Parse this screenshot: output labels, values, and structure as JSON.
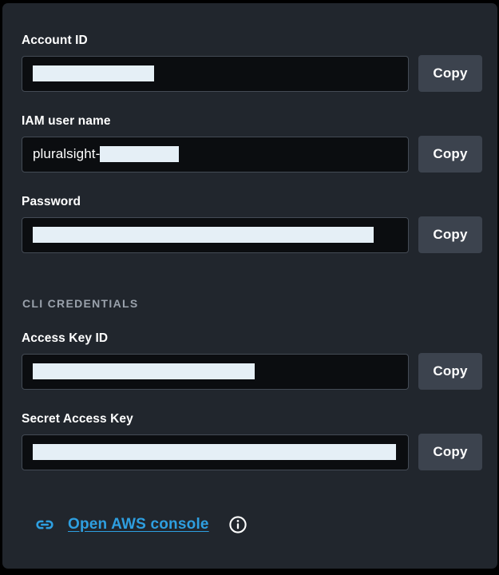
{
  "panel": {
    "background_color": "#21262d"
  },
  "fields": [
    {
      "label": "Account ID",
      "value_prefix": "",
      "redacted": true,
      "redaction_width": 152,
      "copy_label": "Copy"
    },
    {
      "label": "IAM user name",
      "value_prefix": "pluralsight-",
      "redacted": true,
      "redaction_width": 99,
      "copy_label": "Copy"
    },
    {
      "label": "Password",
      "value_prefix": "",
      "redacted": true,
      "redaction_width": 427,
      "copy_label": "Copy"
    }
  ],
  "cli_section": {
    "header": "CLI CREDENTIALS",
    "header_color": "#9aa2ac",
    "fields": [
      {
        "label": "Access Key ID",
        "value_prefix": "",
        "redacted": true,
        "redaction_width": 278,
        "copy_label": "Copy"
      },
      {
        "label": "Secret Access Key",
        "value_prefix": "",
        "redacted": true,
        "redaction_width": 455,
        "copy_label": "Copy"
      }
    ]
  },
  "footer": {
    "link_icon_name": "link-icon",
    "link_label": "Open AWS console",
    "link_color": "#2e9fe0",
    "info_icon_name": "info-icon"
  }
}
